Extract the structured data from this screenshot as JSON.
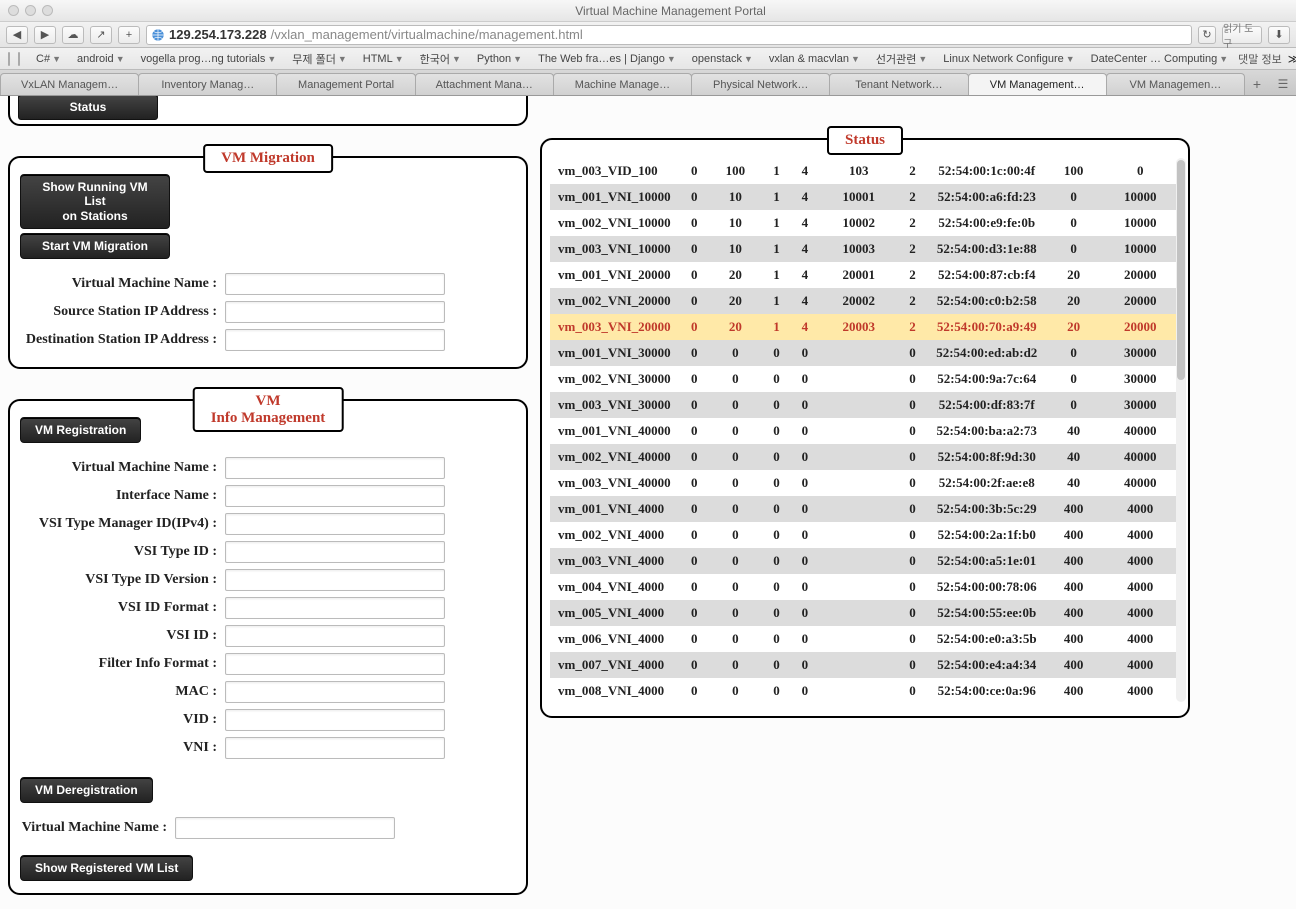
{
  "window": {
    "title": "Virtual Machine Management Portal"
  },
  "browser": {
    "url_host": "129.254.173.228",
    "url_path": "/vxlan_management/virtualmachine/management.html",
    "reader": "읽기 도구",
    "right_label": "댓말 정보",
    "bookmarks": [
      "C#",
      "android",
      "vogella prog…ng tutorials",
      "무제 폴더",
      "HTML",
      "한국어",
      "Python",
      "The Web fra…es | Django",
      "openstack",
      "vxlan & macvlan",
      "선거관련",
      "Linux Network Configure",
      "DateCenter … Computing"
    ],
    "tabs": [
      "VxLAN Managem…",
      "Inventory Manag…",
      "Management Portal",
      "Attachment Mana…",
      "Machine Manage…",
      "Physical Network…",
      "Tenant Network…",
      "VM Management…",
      "VM Managemen…"
    ]
  },
  "leftTop": {
    "status": "Status"
  },
  "migration": {
    "title": "VM Migration",
    "btn_list": "Show Running VM List on Stations",
    "btn_start": "Start VM Migration",
    "f_vm": "Virtual Machine Name :",
    "f_src": "Source Station IP Address :",
    "f_dst": "Destination Station IP Address :"
  },
  "info": {
    "title": "VM Info Management",
    "sec_reg": "VM Registration",
    "f_vm": "Virtual Machine Name :",
    "f_if": "Interface Name :",
    "f_mgr": "VSI Type Manager ID(IPv4) :",
    "f_tid": "VSI Type ID :",
    "f_tidv": "VSI Type ID Version :",
    "f_idf": "VSI ID Format :",
    "f_id": "VSI ID :",
    "f_fif": "Filter Info Format :",
    "f_mac": "MAC :",
    "f_vid": "VID :",
    "f_vni": "VNI :",
    "sec_dereg": "VM Deregistration",
    "f_vm2": "Virtual Machine Name :",
    "btn_show": "Show Registered VM List"
  },
  "status": {
    "title": "Status",
    "rows": [
      {
        "n": "vm_003_VID_100",
        "a": "0",
        "b": "100",
        "c": "1",
        "d": "4",
        "e": "103",
        "f": "2",
        "g": "52:54:00:1c:00:4f",
        "h": "100",
        "i": "0"
      },
      {
        "n": "vm_001_VNI_10000",
        "a": "0",
        "b": "10",
        "c": "1",
        "d": "4",
        "e": "10001",
        "f": "2",
        "g": "52:54:00:a6:fd:23",
        "h": "0",
        "i": "10000"
      },
      {
        "n": "vm_002_VNI_10000",
        "a": "0",
        "b": "10",
        "c": "1",
        "d": "4",
        "e": "10002",
        "f": "2",
        "g": "52:54:00:e9:fe:0b",
        "h": "0",
        "i": "10000"
      },
      {
        "n": "vm_003_VNI_10000",
        "a": "0",
        "b": "10",
        "c": "1",
        "d": "4",
        "e": "10003",
        "f": "2",
        "g": "52:54:00:d3:1e:88",
        "h": "0",
        "i": "10000"
      },
      {
        "n": "vm_001_VNI_20000",
        "a": "0",
        "b": "20",
        "c": "1",
        "d": "4",
        "e": "20001",
        "f": "2",
        "g": "52:54:00:87:cb:f4",
        "h": "20",
        "i": "20000"
      },
      {
        "n": "vm_002_VNI_20000",
        "a": "0",
        "b": "20",
        "c": "1",
        "d": "4",
        "e": "20002",
        "f": "2",
        "g": "52:54:00:c0:b2:58",
        "h": "20",
        "i": "20000"
      },
      {
        "n": "vm_003_VNI_20000",
        "a": "0",
        "b": "20",
        "c": "1",
        "d": "4",
        "e": "20003",
        "f": "2",
        "g": "52:54:00:70:a9:49",
        "h": "20",
        "i": "20000",
        "hl": true
      },
      {
        "n": "vm_001_VNI_30000",
        "a": "0",
        "b": "0",
        "c": "0",
        "d": "0",
        "e": "",
        "f": "0",
        "g": "52:54:00:ed:ab:d2",
        "h": "0",
        "i": "30000"
      },
      {
        "n": "vm_002_VNI_30000",
        "a": "0",
        "b": "0",
        "c": "0",
        "d": "0",
        "e": "",
        "f": "0",
        "g": "52:54:00:9a:7c:64",
        "h": "0",
        "i": "30000"
      },
      {
        "n": "vm_003_VNI_30000",
        "a": "0",
        "b": "0",
        "c": "0",
        "d": "0",
        "e": "",
        "f": "0",
        "g": "52:54:00:df:83:7f",
        "h": "0",
        "i": "30000"
      },
      {
        "n": "vm_001_VNI_40000",
        "a": "0",
        "b": "0",
        "c": "0",
        "d": "0",
        "e": "",
        "f": "0",
        "g": "52:54:00:ba:a2:73",
        "h": "40",
        "i": "40000"
      },
      {
        "n": "vm_002_VNI_40000",
        "a": "0",
        "b": "0",
        "c": "0",
        "d": "0",
        "e": "",
        "f": "0",
        "g": "52:54:00:8f:9d:30",
        "h": "40",
        "i": "40000"
      },
      {
        "n": "vm_003_VNI_40000",
        "a": "0",
        "b": "0",
        "c": "0",
        "d": "0",
        "e": "",
        "f": "0",
        "g": "52:54:00:2f:ae:e8",
        "h": "40",
        "i": "40000"
      },
      {
        "n": "vm_001_VNI_4000",
        "a": "0",
        "b": "0",
        "c": "0",
        "d": "0",
        "e": "",
        "f": "0",
        "g": "52:54:00:3b:5c:29",
        "h": "400",
        "i": "4000"
      },
      {
        "n": "vm_002_VNI_4000",
        "a": "0",
        "b": "0",
        "c": "0",
        "d": "0",
        "e": "",
        "f": "0",
        "g": "52:54:00:2a:1f:b0",
        "h": "400",
        "i": "4000"
      },
      {
        "n": "vm_003_VNI_4000",
        "a": "0",
        "b": "0",
        "c": "0",
        "d": "0",
        "e": "",
        "f": "0",
        "g": "52:54:00:a5:1e:01",
        "h": "400",
        "i": "4000"
      },
      {
        "n": "vm_004_VNI_4000",
        "a": "0",
        "b": "0",
        "c": "0",
        "d": "0",
        "e": "",
        "f": "0",
        "g": "52:54:00:00:78:06",
        "h": "400",
        "i": "4000"
      },
      {
        "n": "vm_005_VNI_4000",
        "a": "0",
        "b": "0",
        "c": "0",
        "d": "0",
        "e": "",
        "f": "0",
        "g": "52:54:00:55:ee:0b",
        "h": "400",
        "i": "4000"
      },
      {
        "n": "vm_006_VNI_4000",
        "a": "0",
        "b": "0",
        "c": "0",
        "d": "0",
        "e": "",
        "f": "0",
        "g": "52:54:00:e0:a3:5b",
        "h": "400",
        "i": "4000"
      },
      {
        "n": "vm_007_VNI_4000",
        "a": "0",
        "b": "0",
        "c": "0",
        "d": "0",
        "e": "",
        "f": "0",
        "g": "52:54:00:e4:a4:34",
        "h": "400",
        "i": "4000"
      },
      {
        "n": "vm_008_VNI_4000",
        "a": "0",
        "b": "0",
        "c": "0",
        "d": "0",
        "e": "",
        "f": "0",
        "g": "52:54:00:ce:0a:96",
        "h": "400",
        "i": "4000"
      }
    ]
  }
}
